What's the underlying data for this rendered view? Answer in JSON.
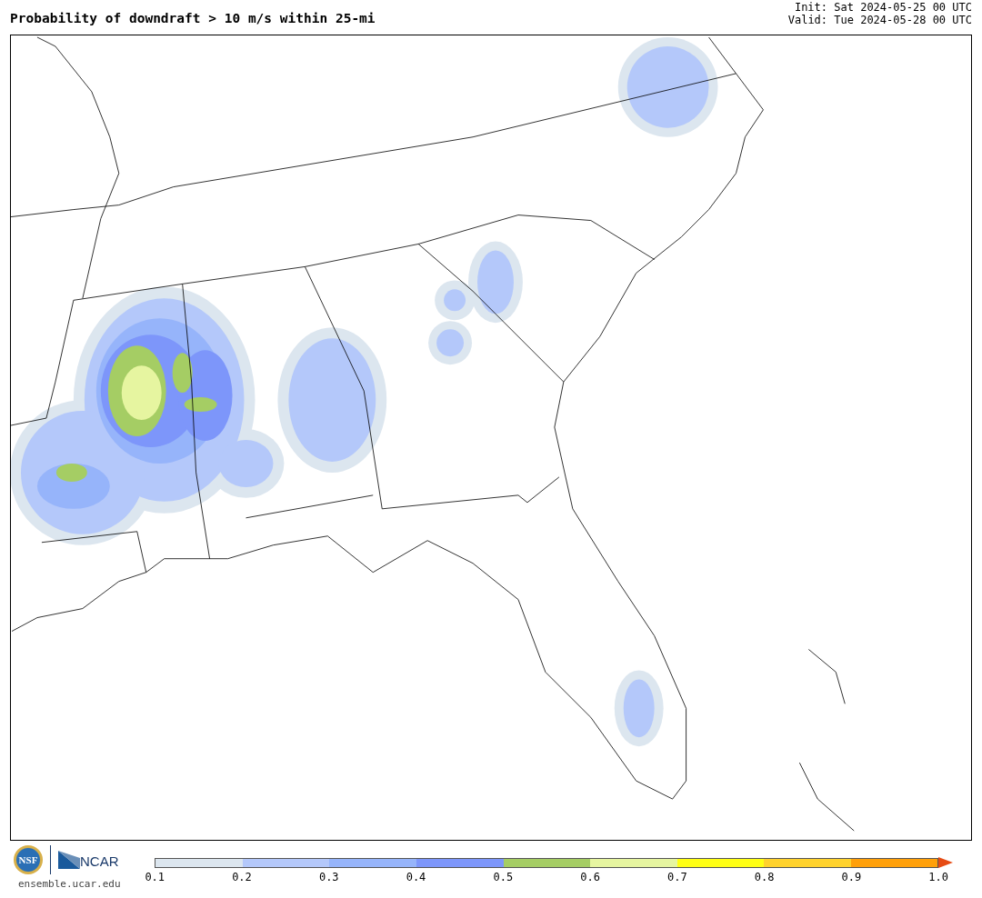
{
  "header": {
    "title": "Probability of downdraft > 10 m/s within 25-mi",
    "init": "Init: Sat 2024-05-25 00 UTC",
    "valid": "Valid: Tue 2024-05-28 00 UTC"
  },
  "footer": {
    "nsf_logo_text": "NSF",
    "ncar_logo_text": "NCAR",
    "url": "ensemble.ucar.edu"
  },
  "colorbar": {
    "bins": [
      {
        "kind": "cell",
        "color": "#dce6ef"
      },
      {
        "kind": "cell",
        "color": "#b4c8fa"
      },
      {
        "kind": "cell",
        "color": "#96b4fa"
      },
      {
        "kind": "cell",
        "color": "#7d96fa"
      },
      {
        "kind": "cell",
        "color": "#a5cd64"
      },
      {
        "kind": "cell",
        "color": "#e6f5a0"
      },
      {
        "kind": "cell",
        "color": "#ffff14"
      },
      {
        "kind": "cell",
        "color": "#ffd22d"
      },
      {
        "kind": "cell",
        "color": "#ffa00a"
      },
      {
        "kind": "arrow",
        "color": "#e64b14"
      }
    ],
    "ticks": [
      "0.1",
      "0.2",
      "0.3",
      "0.4",
      "0.5",
      "0.6",
      "0.7",
      "0.8",
      "0.9",
      "1.0"
    ]
  }
}
